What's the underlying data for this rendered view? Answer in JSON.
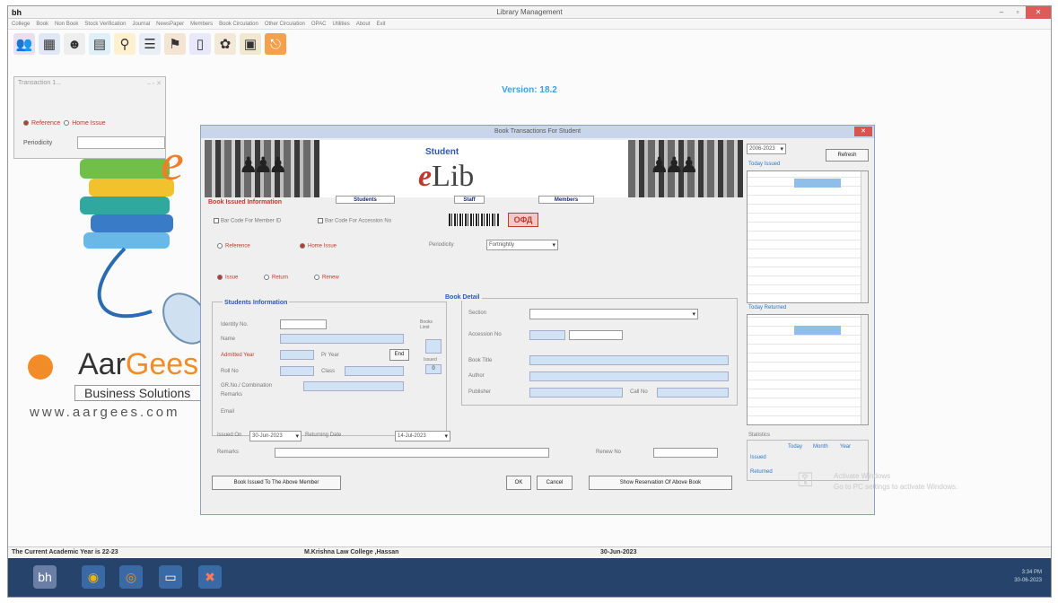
{
  "window": {
    "app_icon_text": "bh",
    "title": "Library Management",
    "minimize": "–",
    "maximize": "▫",
    "close": "✕"
  },
  "menu": [
    "College",
    "Book",
    "Non Book",
    "Stock Verification",
    "Journal",
    "NewsPaper",
    "Members",
    "Book Circulation",
    "Other Circulation",
    "OPAC",
    "Utilities",
    "About",
    "Exit"
  ],
  "toolbar_icons": [
    "members-icon",
    "calendar-icon",
    "person-icon",
    "book-icon",
    "user-icon",
    "list-icon",
    "flag-icon",
    "document-icon",
    "palette-icon",
    "card-icon",
    "exit-icon"
  ],
  "version": "Version: 18.2",
  "transaction_small": {
    "title": "Transaction 1...",
    "reference_label": "Reference",
    "home_issue_label": "Home Issue",
    "period_label": "Periodicity"
  },
  "branding": {
    "e_letter": "e",
    "company_part1": "Aar",
    "company_part2": "Gees",
    "tagline": "Business Solutions",
    "website": "www.aargees.com"
  },
  "dialog": {
    "title": "Book Transactions For Student",
    "banner_student": "Student",
    "banner_e": "e",
    "banner_lib": "Lib",
    "issued_info_title": "Book Issued Information",
    "tabs": [
      "Students",
      "Staff",
      "Members"
    ],
    "barcode_member": "Bar Code For Member ID",
    "barcode_accession": "Bar Code For Accession No",
    "barcode_box": "ОФД",
    "reference": "Reference",
    "home_issue": "Home Issue",
    "periodicity_label": "Periodicity",
    "periodicity_value": "Fortnightly",
    "issue": "Issue",
    "return": "Return",
    "renew": "Renew",
    "students_info_title": "Students Information",
    "identity_no": "Identity No.",
    "name": "Name",
    "admitted_year": "Admitted Year",
    "pr_year": "Pr Year",
    "roll_no": "Roll No",
    "class": "Class",
    "gr_no": "GR.No./ Combination",
    "remarks_inner": "Remarks",
    "email": "Email",
    "book_limit_label": "Books Limit",
    "issued_label": "Issued",
    "issued_value": "0",
    "end_button": "End",
    "book_detail_title": "Book Detail",
    "section": "Section",
    "accession_no": "Accession No",
    "book_title": "Book Title",
    "author": "Author",
    "publisher": "Publisher",
    "call_no": "Call No",
    "issued_on_label": "Issued On",
    "issued_on_value": "30-Jun-2023",
    "returning_date_label": "Returning Date",
    "returning_date_value": "14-Jul-2023",
    "remarks_label": "Remarks",
    "renew_no_label": "Renew No",
    "btn_book_issued": "Book Issued To The Above Member",
    "btn_ok": "OK",
    "btn_cancel": "Cancel",
    "btn_show_reservation": "Show Reservation Of Above Book",
    "year_select": "2006-2023",
    "refresh": "Refresh",
    "today_issued": "Today Issued",
    "today_returned": "Today Returned",
    "statistics": "Statistics",
    "stat_today": "Today",
    "stat_month": "Month",
    "stat_year": "Year",
    "stat_issued": "Issued",
    "stat_returned": "Returned"
  },
  "statusbar": {
    "academic_year": "The Current Academic Year is 22-23",
    "college": "M.Krishna Law College ,Hassan",
    "date": "30-Jun-2023"
  },
  "watermark": {
    "line1": "Activate Windows",
    "line2": "Go to PC settings to activate Windows."
  },
  "taskbar": {
    "icons": [
      "library-app-icon",
      "chrome-icon",
      "media-icon",
      "explorer-icon",
      "tool-icon"
    ],
    "time": "3:34 PM",
    "date": "30-06-2023"
  }
}
